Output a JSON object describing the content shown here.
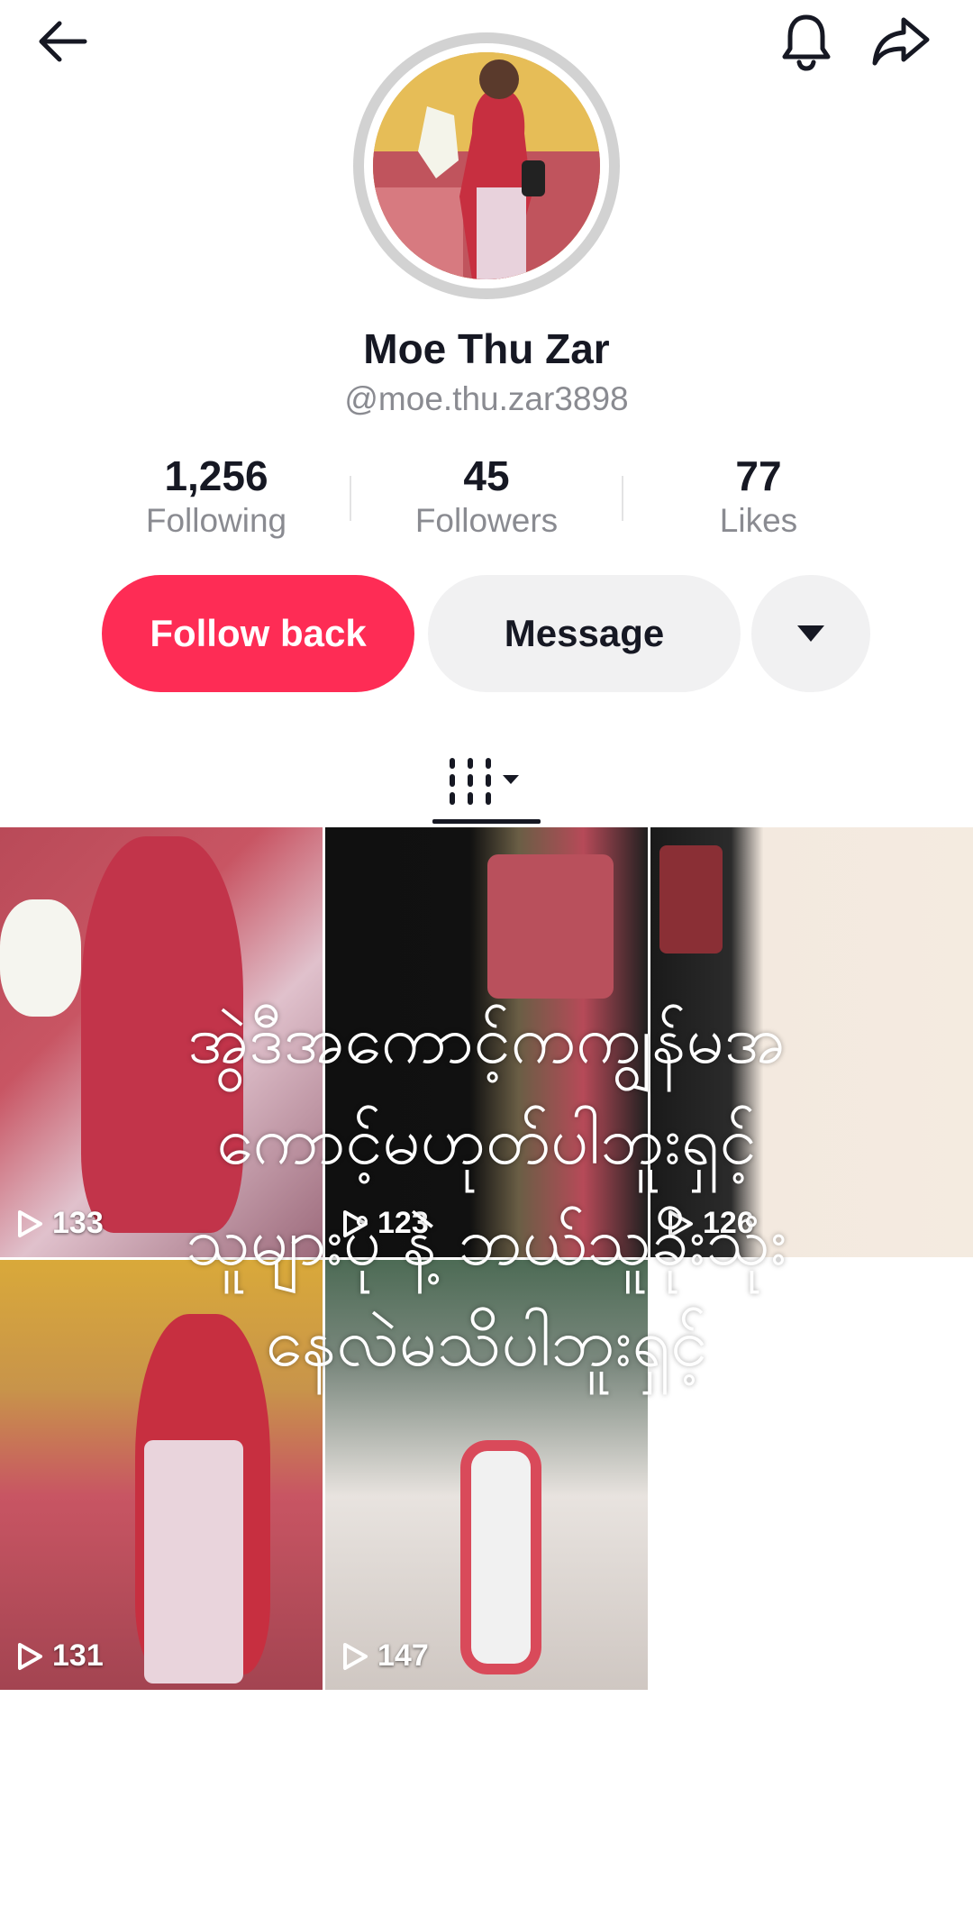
{
  "profile": {
    "name": "Moe Thu Zar",
    "handle": "@moe.thu.zar3898"
  },
  "stats": [
    {
      "value": "1,256",
      "label": "Following"
    },
    {
      "value": "45",
      "label": "Followers"
    },
    {
      "value": "77",
      "label": "Likes"
    }
  ],
  "actions": {
    "follow_back": "Follow back",
    "message": "Message"
  },
  "icons": {
    "back": "arrow-left-icon",
    "bell": "bell-icon",
    "share": "share-arrow-icon",
    "more": "triangle-down-icon",
    "tab": "videos-grid-icon",
    "play": "play-outline-icon"
  },
  "colors": {
    "accent": "#fe2c55",
    "secondary_button": "#f1f1f2",
    "muted_text": "#8a8b91"
  },
  "videos": [
    {
      "views": "133"
    },
    {
      "views": "123"
    },
    {
      "views": "126"
    },
    {
      "views": "131"
    },
    {
      "views": "147"
    }
  ],
  "overlay_text": [
    "အွဲဒီအကောင့်ကကျွန်မအ",
    "ကောင့်မဟုတ်ပါဘူးရှင့်",
    "သူများပုံ နဲ့ ဘယ်သူခိုးသုံး",
    "နေလဲမသိပါဘူးရှင့်"
  ]
}
